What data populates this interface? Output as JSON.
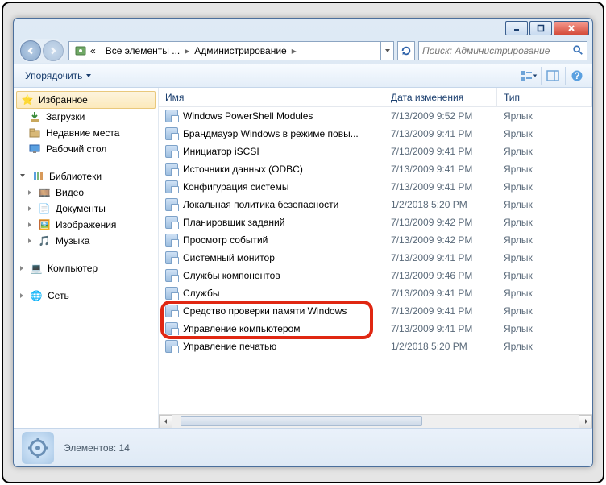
{
  "window": {
    "breadcrumb": {
      "root_trail": "«",
      "seg1": "Все элементы ...",
      "seg2": "Администрирование"
    },
    "search_placeholder": "Поиск: Администрирование"
  },
  "toolbar": {
    "organize": "Упорядочить"
  },
  "sidebar": {
    "favorites": {
      "label": "Избранное",
      "items": [
        "Загрузки",
        "Недавние места",
        "Рабочий стол"
      ]
    },
    "libraries": {
      "label": "Библиотеки",
      "items": [
        "Видео",
        "Документы",
        "Изображения",
        "Музыка"
      ]
    },
    "computer": {
      "label": "Компьютер"
    },
    "network": {
      "label": "Сеть"
    }
  },
  "columns": {
    "name": "Имя",
    "date": "Дата изменения",
    "type": "Тип"
  },
  "files": [
    {
      "name": "Windows PowerShell Modules",
      "date": "7/13/2009 9:52 PM",
      "type": "Ярлык"
    },
    {
      "name": "Брандмауэр Windows в режиме повы...",
      "date": "7/13/2009 9:41 PM",
      "type": "Ярлык"
    },
    {
      "name": "Инициатор iSCSI",
      "date": "7/13/2009 9:41 PM",
      "type": "Ярлык"
    },
    {
      "name": "Источники данных (ODBC)",
      "date": "7/13/2009 9:41 PM",
      "type": "Ярлык"
    },
    {
      "name": "Конфигурация системы",
      "date": "7/13/2009 9:41 PM",
      "type": "Ярлык"
    },
    {
      "name": "Локальная политика безопасности",
      "date": "1/2/2018 5:20 PM",
      "type": "Ярлык"
    },
    {
      "name": "Планировщик заданий",
      "date": "7/13/2009 9:42 PM",
      "type": "Ярлык"
    },
    {
      "name": "Просмотр событий",
      "date": "7/13/2009 9:42 PM",
      "type": "Ярлык"
    },
    {
      "name": "Системный монитор",
      "date": "7/13/2009 9:41 PM",
      "type": "Ярлык"
    },
    {
      "name": "Службы компонентов",
      "date": "7/13/2009 9:46 PM",
      "type": "Ярлык"
    },
    {
      "name": "Службы",
      "date": "7/13/2009 9:41 PM",
      "type": "Ярлык"
    },
    {
      "name": "Средство проверки памяти Windows",
      "date": "7/13/2009 9:41 PM",
      "type": "Ярлык"
    },
    {
      "name": "Управление компьютером",
      "date": "7/13/2009 9:41 PM",
      "type": "Ярлык"
    },
    {
      "name": "Управление печатью",
      "date": "1/2/2018 5:20 PM",
      "type": "Ярлык"
    }
  ],
  "status": {
    "text": "Элементов: 14"
  },
  "highlight_index": 12
}
